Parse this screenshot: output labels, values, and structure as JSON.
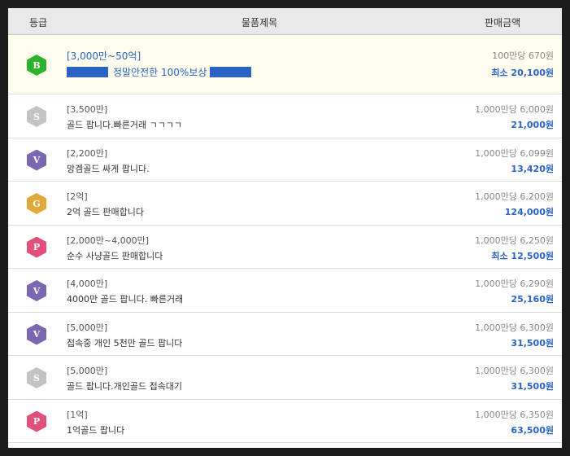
{
  "header": {
    "grade": "등급",
    "title": "물품제목",
    "price": "판매금액"
  },
  "premium": {
    "badge": "B",
    "badge_color": "#2fb12f",
    "tier": "[3,000만~50억]",
    "title": "정말안전한 100%보상",
    "unit_price": "100만당 670원",
    "total": "최소 20,100원"
  },
  "rows": [
    {
      "badge": "S",
      "badge_color": "#c3c3c3",
      "tier": "[3,500만]",
      "title": "골드 팝니다.빠른거래 ㄱㄱㄱㄱ",
      "unit_price": "1,000만당 6,000원",
      "total": "21,000원"
    },
    {
      "badge": "V",
      "badge_color": "#7a67b0",
      "tier": "[2,200만]",
      "title": "망겜골드 싸게 팝니다.",
      "unit_price": "1,000만당 6,099원",
      "total": "13,420원"
    },
    {
      "badge": "G",
      "badge_color": "#e0a93a",
      "tier": "[2억]",
      "title": "2억 골드 판매합니다",
      "unit_price": "1,000만당 6,200원",
      "total": "124,000원"
    },
    {
      "badge": "P",
      "badge_color": "#e0507a",
      "tier": "[2,000만~4,000만]",
      "title": "순수 사냥골드 판매합니다",
      "unit_price": "1,000만당 6,250원",
      "total": "최소 12,500원"
    },
    {
      "badge": "V",
      "badge_color": "#7a67b0",
      "tier": "[4,000만]",
      "title": "4000만 골드 팝니다. 빠른거래",
      "unit_price": "1,000만당 6,290원",
      "total": "25,160원"
    },
    {
      "badge": "V",
      "badge_color": "#7a67b0",
      "tier": "[5,000만]",
      "title": "접속중 개인 5천만 골드 팝니다",
      "unit_price": "1,000만당 6,300원",
      "total": "31,500원"
    },
    {
      "badge": "S",
      "badge_color": "#c3c3c3",
      "tier": "[5,000만]",
      "title": "골드 팝니다.개인골드 접속대기",
      "unit_price": "1,000만당 6,300원",
      "total": "31,500원"
    },
    {
      "badge": "P",
      "badge_color": "#e0507a",
      "tier": "[1억]",
      "title": "1억골드 팝니다",
      "unit_price": "1,000만당 6,350원",
      "total": "63,500원"
    }
  ]
}
